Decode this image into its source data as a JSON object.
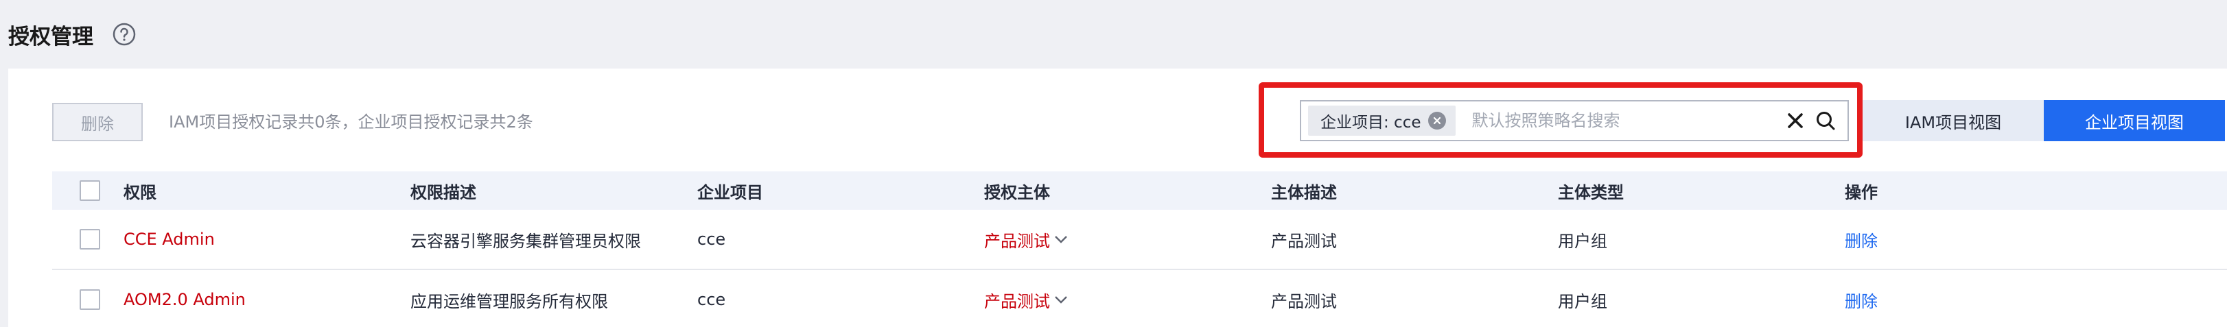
{
  "header": {
    "title": "授权管理"
  },
  "toolbar": {
    "delete_label": "删除",
    "records_text": "IAM项目授权记录共0条，企业项目授权记录共2条"
  },
  "search": {
    "tag_label": "企业项目: cce",
    "placeholder": "默认按照策略名搜索"
  },
  "view_toggle": {
    "iam_label": "IAM项目视图",
    "enterprise_label": "企业项目视图"
  },
  "table": {
    "headers": [
      "权限",
      "权限描述",
      "企业项目",
      "授权主体",
      "主体描述",
      "主体类型",
      "操作"
    ],
    "rows": [
      {
        "permission": "CCE Admin",
        "description": "云容器引擎服务集群管理员权限",
        "enterprise_project": "cce",
        "subject": "产品测试",
        "subject_desc": "产品测试",
        "subject_type": "用户组",
        "action": "删除"
      },
      {
        "permission": "AOM2.0 Admin",
        "description": "应用运维管理服务所有权限",
        "enterprise_project": "cce",
        "subject": "产品测试",
        "subject_desc": "产品测试",
        "subject_type": "用户组",
        "action": "删除"
      }
    ]
  },
  "colors": {
    "accent": "#1f6af0",
    "danger_link": "#c7000b",
    "highlight": "#e51c1c"
  }
}
